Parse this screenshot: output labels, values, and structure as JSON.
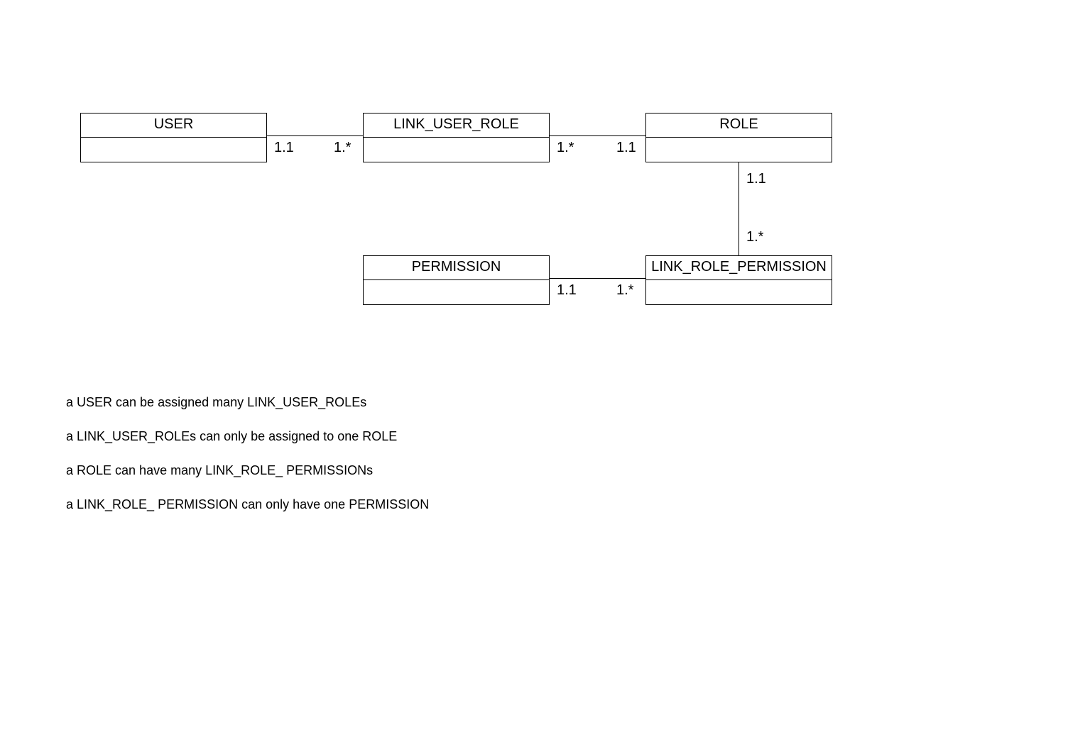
{
  "entities": {
    "user": {
      "label": "USER"
    },
    "link_user_role": {
      "label": "LINK_USER_ROLE"
    },
    "role": {
      "label": "ROLE"
    },
    "permission": {
      "label": "PERMISSION"
    },
    "link_role_permission": {
      "label": "LINK_ROLE_PERMISSION"
    }
  },
  "cardinalities": {
    "user_to_lur_left": "1.1",
    "user_to_lur_right": "1.*",
    "lur_to_role_left": "1.*",
    "lur_to_role_right": "1.1",
    "role_to_lrp_top": "1.1",
    "role_to_lrp_bottom": "1.*",
    "perm_to_lrp_left": "1.1",
    "perm_to_lrp_right": "1.*"
  },
  "descriptions": {
    "d1": "a USER can be assigned many LINK_USER_ROLEs",
    "d2": "a LINK_USER_ROLEs can only be assigned to one ROLE",
    "d3": "a ROLE can have many LINK_ROLE_ PERMISSIONs",
    "d4": "a LINK_ROLE_ PERMISSION can only have one PERMISSION"
  }
}
